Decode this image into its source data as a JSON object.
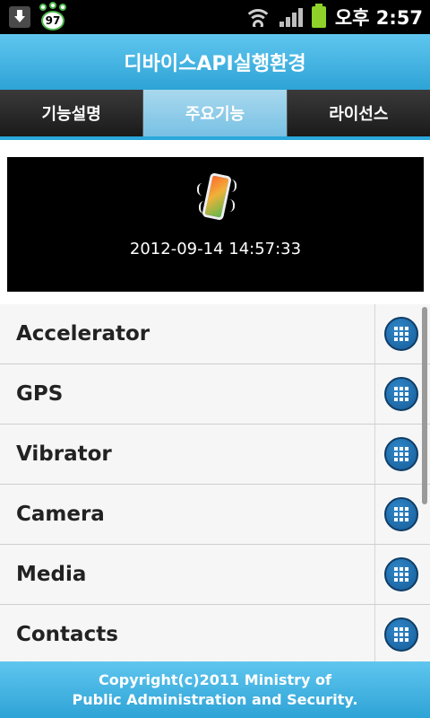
{
  "status_bar": {
    "notification_badge": "97",
    "time": "오후 2:57",
    "icons": [
      "download-icon",
      "paw-badge-icon",
      "wifi-icon",
      "signal-icon",
      "battery-icon"
    ]
  },
  "app": {
    "title": "디바이스API실행환경"
  },
  "tabs": [
    {
      "label": "기능설명",
      "active": false
    },
    {
      "label": "주요기능",
      "active": true
    },
    {
      "label": "라이선스",
      "active": false
    }
  ],
  "display": {
    "icon": "vibrating-phone-icon",
    "timestamp": "2012-09-14 14:57:33"
  },
  "list": {
    "items": [
      {
        "label": "Accelerator"
      },
      {
        "label": "GPS"
      },
      {
        "label": "Vibrator"
      },
      {
        "label": "Camera"
      },
      {
        "label": "Media"
      },
      {
        "label": "Contacts"
      }
    ]
  },
  "footer": {
    "line1": "Copyright(c)2011 Ministry of",
    "line2": "Public Administration and Security."
  },
  "colors": {
    "accent": "#2ea3d6",
    "tab_active": "#8fcbe8",
    "list_button": "#1f6fb0"
  }
}
